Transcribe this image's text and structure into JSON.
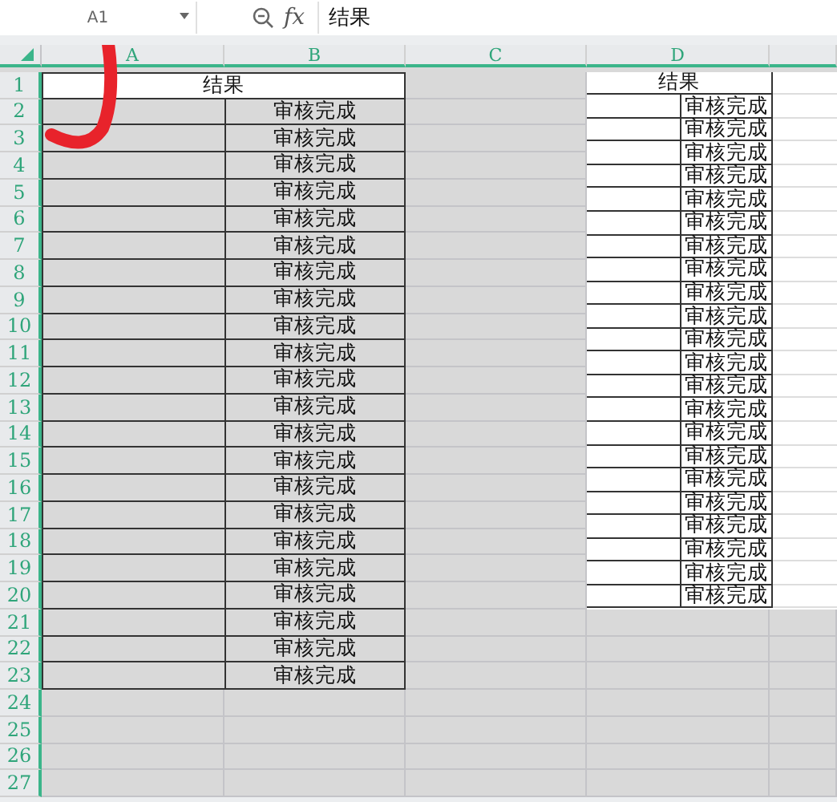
{
  "toolbar": {
    "name_box": "A1",
    "formula_label": "fx",
    "formula": "结果"
  },
  "columns": [
    "A",
    "B",
    "C",
    "D"
  ],
  "row_numbers": [
    "1",
    "2",
    "3",
    "4",
    "5",
    "6",
    "7",
    "8",
    "9",
    "10",
    "11",
    "12",
    "13",
    "14",
    "15",
    "16",
    "17",
    "18",
    "19",
    "20",
    "21",
    "22",
    "23",
    "24",
    "25",
    "26",
    "27"
  ],
  "table": {
    "title": "结果",
    "cells": [
      "审核完成",
      "审核完成",
      "审核完成",
      "审核完成",
      "审核完成",
      "审核完成",
      "审核完成",
      "审核完成",
      "审核完成",
      "审核完成",
      "审核完成",
      "审核完成",
      "审核完成",
      "审核完成",
      "审核完成",
      "审核完成",
      "审核完成",
      "审核完成",
      "审核完成",
      "审核完成",
      "审核完成",
      "审核完成"
    ]
  },
  "pasted_table": {
    "title": "结果",
    "cells": [
      "审核完成",
      "审核完成",
      "审核完成",
      "审核完成",
      "审核完成",
      "审核完成",
      "审核完成",
      "审核完成",
      "审核完成",
      "审核完成",
      "审核完成",
      "审核完成",
      "审核完成",
      "审核完成",
      "审核完成",
      "审核完成",
      "审核完成",
      "审核完成",
      "审核完成",
      "审核完成",
      "审核完成",
      "审核完成"
    ]
  }
}
